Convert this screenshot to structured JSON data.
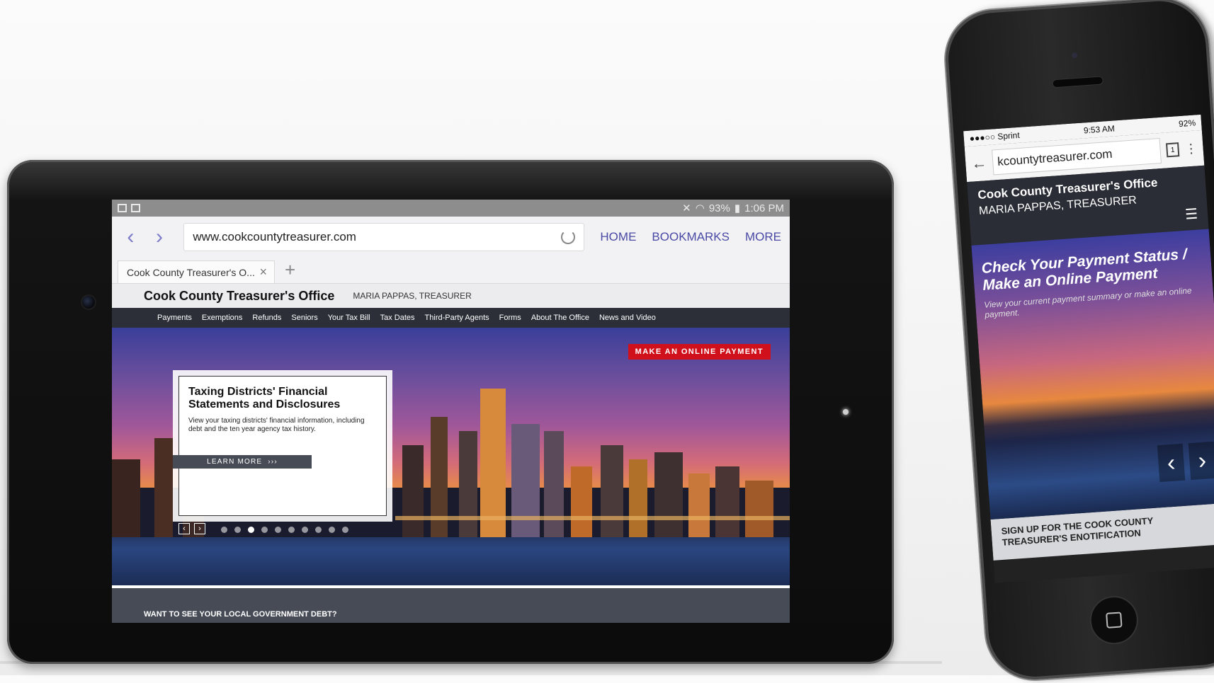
{
  "tablet": {
    "status": {
      "battery": "93%",
      "time": "1:06 PM"
    },
    "browser": {
      "url": "www.cookcountytreasurer.com",
      "links": [
        "HOME",
        "BOOKMARKS",
        "MORE"
      ],
      "tab_title": "Cook County Treasurer's O...",
      "new_tab": "+"
    },
    "site": {
      "title": "Cook County Treasurer's Office",
      "subtitle": "MARIA PAPPAS, TREASURER",
      "nav": [
        "Payments",
        "Exemptions",
        "Refunds",
        "Seniors",
        "Your Tax Bill",
        "Tax Dates",
        "Third-Party Agents",
        "Forms",
        "About The Office",
        "News and Video"
      ],
      "pay_button": "MAKE AN ONLINE PAYMENT",
      "card": {
        "title_line1": "Taxing Districts' Financial",
        "title_line2": "Statements and Disclosures",
        "body": "View your taxing districts' financial information, including debt and the ten year agency tax history.",
        "button": "LEARN MORE",
        "button_chevrons": "›››"
      },
      "debt_band": "WANT TO SEE YOUR LOCAL GOVERNMENT DEBT?"
    }
  },
  "phone": {
    "status": {
      "carrier": "Sprint",
      "time": "9:53 AM",
      "battery": "92%"
    },
    "url": "kcountytreasurer.com",
    "tab_count": "1",
    "header": {
      "title": "Cook County Treasurer's Office",
      "subtitle": "MARIA PAPPAS, TREASURER"
    },
    "hero": {
      "title": "Check Your Payment Status / Make an Online Payment",
      "body": "View your current payment summary or make an online payment."
    },
    "signup": "SIGN UP FOR THE COOK COUNTY TREASURER'S ENOTIFICATION"
  }
}
